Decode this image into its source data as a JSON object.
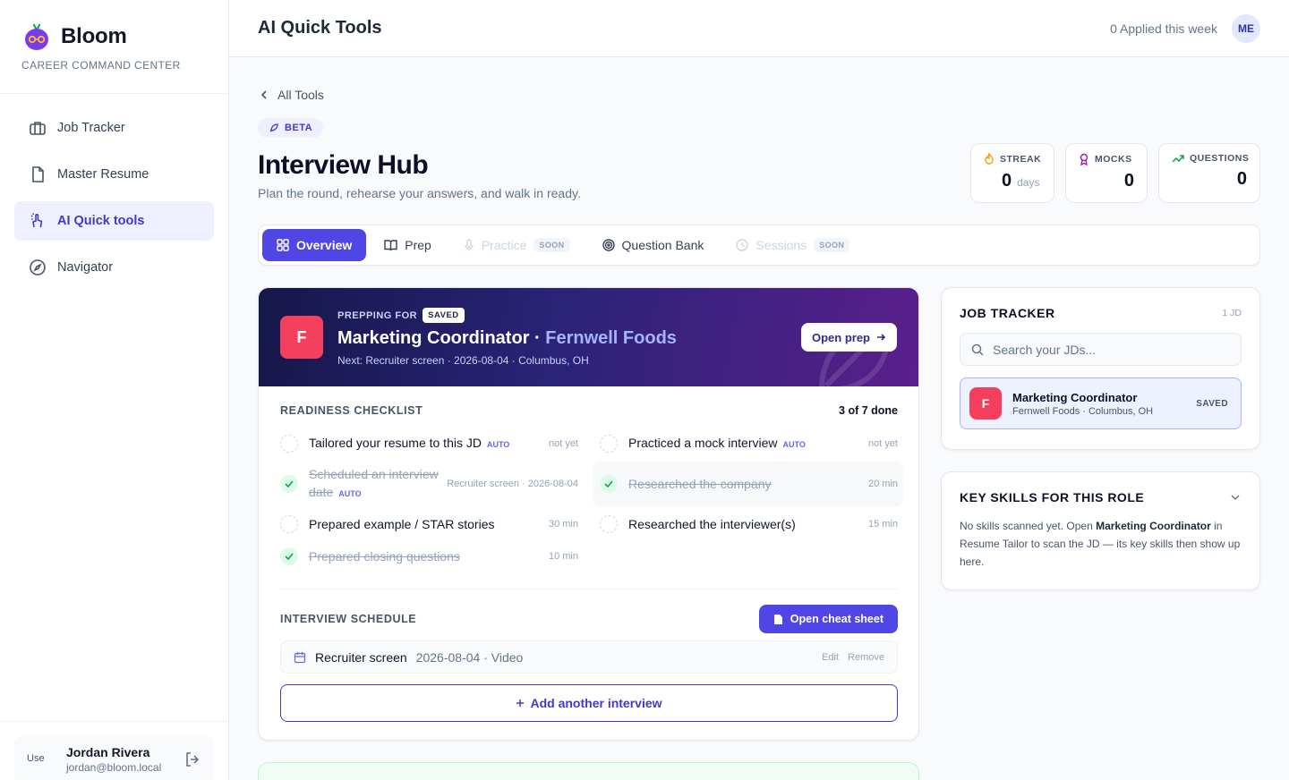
{
  "brand": {
    "name": "Bloom",
    "subtitle": "CAREER COMMAND CENTER"
  },
  "nav": [
    {
      "label": "Job Tracker",
      "icon": "briefcase-icon"
    },
    {
      "label": "Master Resume",
      "icon": "document-icon"
    },
    {
      "label": "AI Quick tools",
      "icon": "magic-hand-icon",
      "active": true
    },
    {
      "label": "Navigator",
      "icon": "compass-icon"
    }
  ],
  "user": {
    "name": "Jordan Rivera",
    "email": "jordan@bloom.local",
    "avatar_alt": "Use"
  },
  "header": {
    "title": "AI Quick Tools",
    "applied": "0 Applied this week",
    "initials": "ME"
  },
  "page": {
    "back": "All Tools",
    "badge": "BETA",
    "title": "Interview Hub",
    "subtitle": "Plan the round, rehearse your answers, and walk in ready."
  },
  "stats": {
    "streak": {
      "label": "STREAK",
      "value": "0",
      "unit": "days"
    },
    "mocks": {
      "label": "MOCKS",
      "value": "0"
    },
    "questions": {
      "label": "QUESTIONS",
      "value": "0"
    }
  },
  "tabs": [
    {
      "label": "Overview",
      "icon": "grid-icon",
      "active": true
    },
    {
      "label": "Prep",
      "icon": "book-icon"
    },
    {
      "label": "Practice",
      "icon": "mic-icon",
      "disabled": true,
      "tag": "SOON"
    },
    {
      "label": "Question Bank",
      "icon": "target-icon"
    },
    {
      "label": "Sessions",
      "icon": "clock-icon",
      "disabled": true,
      "tag": "SOON"
    }
  ],
  "prep": {
    "label": "PREPPING FOR",
    "status": "SAVED",
    "logo_letter": "F",
    "role": "Marketing Coordinator",
    "separator": " · ",
    "company": "Fernwell Foods",
    "next": "Next: Recruiter screen · 2026-08-04 · Columbus, OH",
    "open_label": "Open prep"
  },
  "checklist": {
    "title": "READINESS CHECKLIST",
    "count": "3 of 7 done",
    "auto_label": "AUTO",
    "items": [
      {
        "text": "Tailored your resume to this JD",
        "auto": true,
        "meta": "not yet",
        "done": false
      },
      {
        "text": "Practiced a mock interview",
        "auto": true,
        "meta": "not yet",
        "done": false
      },
      {
        "text": "Scheduled an interview date",
        "auto": true,
        "meta": "Recruiter screen · 2026-08-04",
        "done": true
      },
      {
        "text": "Researched the company",
        "auto": false,
        "meta": "20 min",
        "done": true
      },
      {
        "text": "Prepared example / STAR stories",
        "auto": false,
        "meta": "30 min",
        "done": false
      },
      {
        "text": "Researched the interviewer(s)",
        "auto": false,
        "meta": "15 min",
        "done": false
      },
      {
        "text": "Prepared closing questions",
        "auto": false,
        "meta": "10 min",
        "done": true
      }
    ]
  },
  "schedule": {
    "title": "INTERVIEW SCHEDULE",
    "cheat_label": "Open cheat sheet",
    "row": {
      "type": "Recruiter screen",
      "details": "2026-08-04 · Video",
      "edit": "Edit",
      "remove": "Remove"
    },
    "add_label": "Add another interview"
  },
  "job_tracker": {
    "title": "JOB TRACKER",
    "count": "1 JD",
    "search_placeholder": "Search your JDs...",
    "item": {
      "letter": "F",
      "role": "Marketing Coordinator",
      "sub": "Fernwell Foods · Columbus, OH",
      "status": "SAVED"
    }
  },
  "skills": {
    "title": "KEY SKILLS FOR THIS ROLE",
    "text_before": "No skills scanned yet. Open ",
    "text_role": "Marketing Coordinator",
    "text_after": " in Resume Tailor to scan the JD — its key skills then show up here."
  },
  "colors": {
    "accent": "#4f46e5",
    "brand_logo": "#f43f5e",
    "success": "#16a34a"
  }
}
